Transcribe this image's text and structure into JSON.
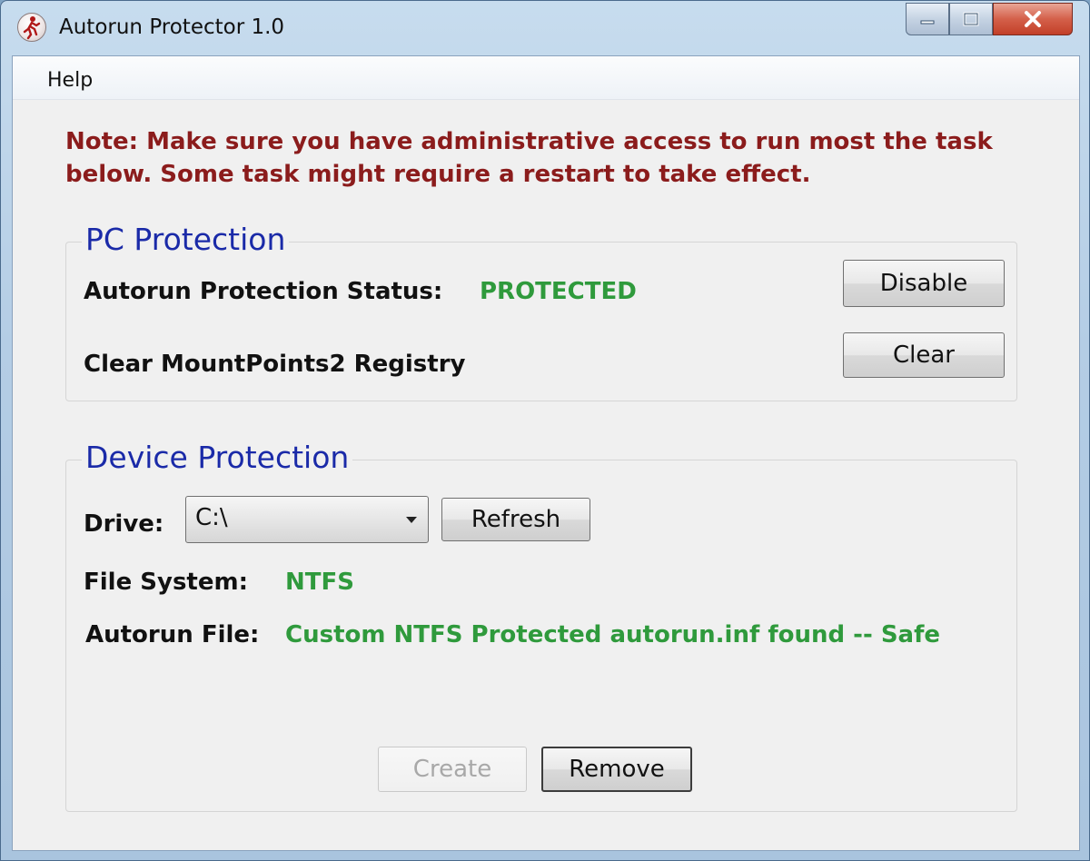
{
  "window": {
    "title": "Autorun Protector 1.0",
    "icon": "app-runner-icon",
    "caption_icons": [
      "minimize-icon",
      "maximize-icon",
      "close-icon"
    ]
  },
  "menu": {
    "items": [
      {
        "label": "Help"
      }
    ]
  },
  "note": "Note: Make sure you have administrative access to run most the task below. Some task might require a restart to take effect.",
  "pc_protection": {
    "title": "PC Protection",
    "status_label": "Autorun Protection Status:",
    "status_value": "PROTECTED",
    "disable_label": "Disable",
    "clear_registry_label": "Clear MountPoints2 Registry",
    "clear_label": "Clear"
  },
  "device_protection": {
    "title": "Device Protection",
    "drive_label": "Drive:",
    "drive_value": "C:\\",
    "refresh_label": "Refresh",
    "filesystem_label": "File System:",
    "filesystem_value": "NTFS",
    "autorun_label": "Autorun File:",
    "autorun_value": "Custom NTFS Protected autorun.inf found -- Safe",
    "create_label": "Create",
    "remove_label": "Remove"
  },
  "colors": {
    "note_red": "#8b1c1c",
    "group_title_blue": "#1a2aa8",
    "status_green": "#2f9a3c"
  }
}
